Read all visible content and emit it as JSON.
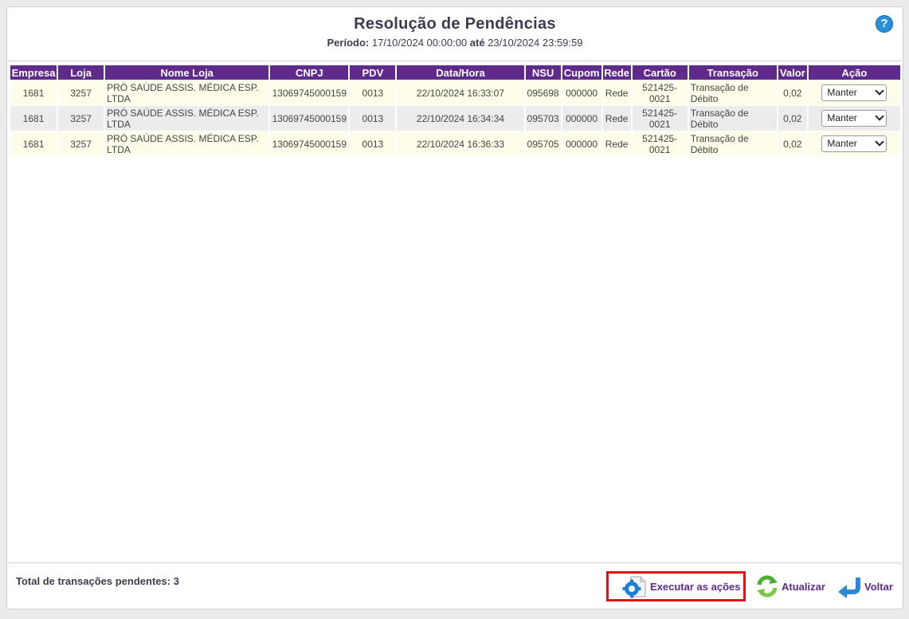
{
  "page": {
    "title": "Resolução de Pendências",
    "period_label": "Período:",
    "period_start": "17/10/2024 00:00:00",
    "period_sep": "até",
    "period_end": "23/10/2024 23:59:59",
    "help_glyph": "?"
  },
  "table": {
    "columns": [
      "Empresa",
      "Loja",
      "Nome Loja",
      "CNPJ",
      "PDV",
      "Data/Hora",
      "NSU",
      "Cupom",
      "Rede",
      "Cartão",
      "Transação",
      "Valor",
      "Ação"
    ],
    "rows": [
      {
        "empresa": "1681",
        "loja": "3257",
        "nome": "PRÓ SAÚDE ASSIS. MÉDICA ESP. LTDA",
        "cnpj": "13069745000159",
        "pdv": "0013",
        "data": "22/10/2024 16:33:07",
        "nsu": "095698",
        "cupom": "000000",
        "rede": "Rede",
        "cartao": "521425-0021",
        "transacao": "Transação de Débito",
        "valor": "0,02",
        "acao": "Manter"
      },
      {
        "empresa": "1681",
        "loja": "3257",
        "nome": "PRÓ SAÚDE ASSIS. MÉDICA ESP. LTDA",
        "cnpj": "13069745000159",
        "pdv": "0013",
        "data": "22/10/2024 16:34:34",
        "nsu": "095703",
        "cupom": "000000",
        "rede": "Rede",
        "cartao": "521425-0021",
        "transacao": "Transação de Débito",
        "valor": "0,02",
        "acao": "Manter"
      },
      {
        "empresa": "1681",
        "loja": "3257",
        "nome": "PRÓ SAÚDE ASSIS. MÉDICA ESP. LTDA",
        "cnpj": "13069745000159",
        "pdv": "0013",
        "data": "22/10/2024 16:36:33",
        "nsu": "095705",
        "cupom": "000000",
        "rede": "Rede",
        "cartao": "521425-0021",
        "transacao": "Transação de Débito",
        "valor": "0,02",
        "acao": "Manter"
      }
    ]
  },
  "footer": {
    "total_label": "Total de transações pendentes: 3",
    "execute_label": "Executar as ações",
    "refresh_label": "Atualizar",
    "back_label": "Voltar"
  },
  "colors": {
    "header_bg": "#5f2a8c",
    "row_odd": "#fdfde9",
    "row_even": "#ececec",
    "highlight": "#e3101a",
    "help": "#2a8fdb"
  },
  "icons": {
    "help": "question-circle-icon",
    "execute": "gear-document-icon",
    "refresh": "refresh-arrows-icon",
    "back": "back-arrow-icon"
  }
}
